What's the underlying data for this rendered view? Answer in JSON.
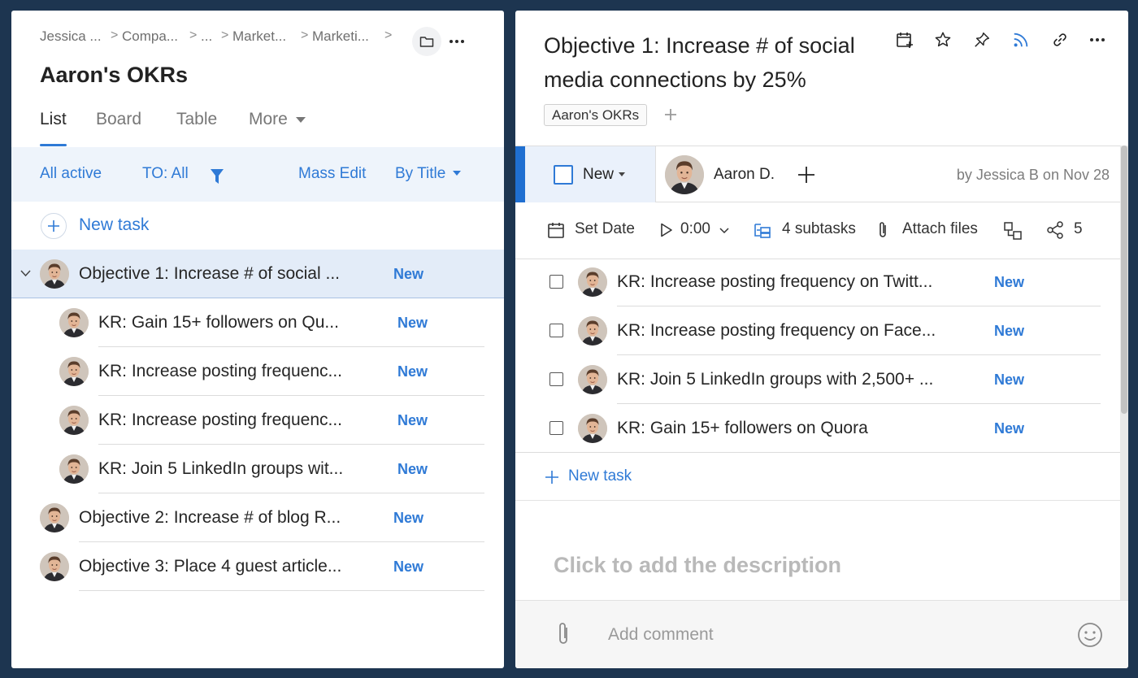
{
  "left": {
    "breadcrumb": [
      "Jessica ...",
      "Compa...",
      "...",
      "Market...",
      "Marketi..."
    ],
    "title": "Aaron's OKRs",
    "tabs": [
      "List",
      "Board",
      "Table",
      "More"
    ],
    "active_tab": "List",
    "filters": {
      "status": "All active",
      "to": "TO: All",
      "mass_edit": "Mass Edit",
      "sort": "By Title"
    },
    "new_task": "New task",
    "tasks": [
      {
        "title": "Objective 1: Increase # of social ...",
        "status": "New",
        "level": 0,
        "expanded": true,
        "selected": true
      },
      {
        "title": "KR: Gain 15+ followers on Qu...",
        "status": "New",
        "level": 1
      },
      {
        "title": "KR: Increase posting frequenc...",
        "status": "New",
        "level": 1
      },
      {
        "title": "KR: Increase posting frequenc...",
        "status": "New",
        "level": 1
      },
      {
        "title": "KR: Join 5 LinkedIn groups wit...",
        "status": "New",
        "level": 1
      },
      {
        "title": "Objective 2: Increase # of blog R...",
        "status": "New",
        "level": 0
      },
      {
        "title": "Objective 3: Place 4 guest article...",
        "status": "New",
        "level": 0
      }
    ]
  },
  "right": {
    "title": "Objective 1: Increase # of social media connections by 25%",
    "tag": "Aaron's OKRs",
    "status": "New",
    "assignee": "Aaron D.",
    "author_line": "by Jessica B on Nov 28",
    "toolbar": {
      "set_date": "Set Date",
      "timer": "0:00",
      "subtasks": "4 subtasks",
      "attach": "Attach files",
      "share_count": "5"
    },
    "subtasks": [
      {
        "title": "KR: Increase posting frequency on Twitt...",
        "status": "New"
      },
      {
        "title": "KR: Increase posting frequency on Face...",
        "status": "New"
      },
      {
        "title": "KR: Join 5 LinkedIn groups with 2,500+ ...",
        "status": "New"
      },
      {
        "title": "KR: Gain 15+ followers on Quora",
        "status": "New"
      }
    ],
    "new_task": "New task",
    "description_placeholder": "Click to add the description",
    "comment_placeholder": "Add comment"
  },
  "colors": {
    "background": "#1d3550",
    "accent": "#2f7ad6",
    "selected_row": "#e3ecf8",
    "filter_bar": "#eef4fb"
  }
}
